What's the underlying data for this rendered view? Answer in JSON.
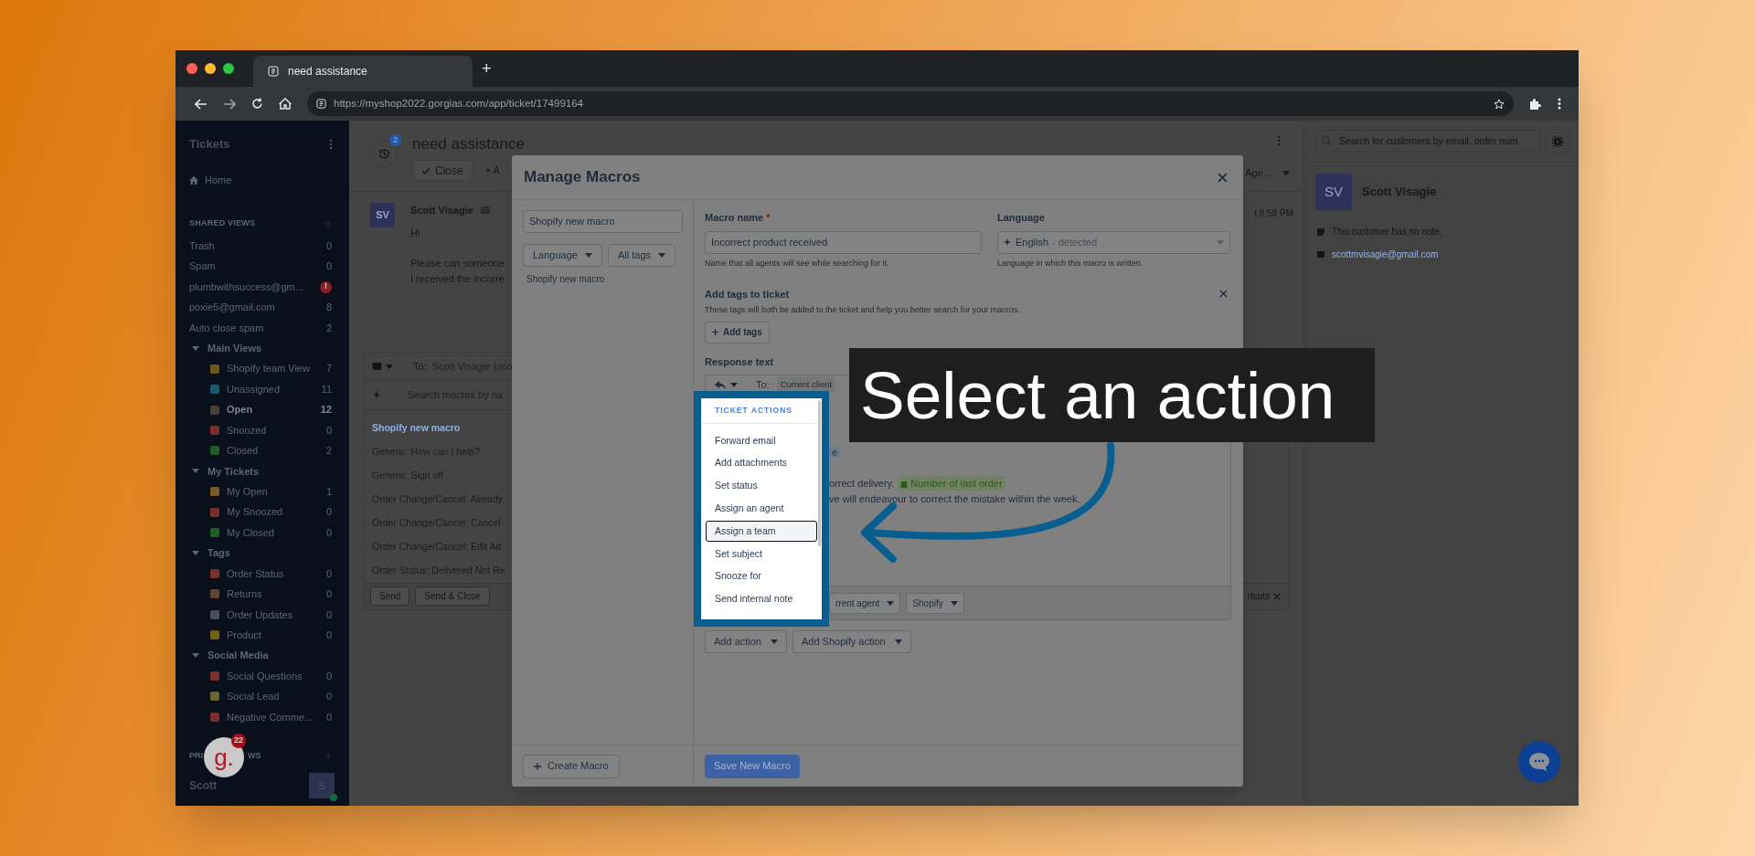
{
  "browser": {
    "tab_title": "need assistance",
    "new_tab": "+",
    "url": "https://myshop2022.gorgias.com/app/ticket/17499164"
  },
  "sidebar": {
    "title": "Tickets",
    "home": "Home",
    "shared_views_label": "SHARED VIEWS",
    "shared_views": [
      {
        "label": "Trash",
        "count": "0",
        "kind": "plain"
      },
      {
        "label": "Spam",
        "count": "0",
        "kind": "plain"
      },
      {
        "label": "plumbwithsuccess@gm...",
        "count": "!",
        "kind": "alert"
      },
      {
        "label": "poxie5@gmail.com",
        "count": "8",
        "kind": "plain"
      },
      {
        "label": "Auto close spam",
        "count": "2",
        "kind": "plain"
      }
    ],
    "groups": [
      {
        "label": "Main Views",
        "expanded": true,
        "children": [
          {
            "label": "Shopify team View",
            "count": "7",
            "color": "#6b5a1c",
            "selected": false
          },
          {
            "label": "Unassigned",
            "count": "11",
            "color": "#1a5a6e",
            "selected": false
          },
          {
            "label": "Open",
            "count": "12",
            "color": "#4a4038",
            "selected": true
          },
          {
            "label": "Snoozed",
            "count": "0",
            "color": "#7a2f2c",
            "selected": false
          },
          {
            "label": "Closed",
            "count": "2",
            "color": "#1f5e27",
            "selected": false
          }
        ]
      },
      {
        "label": "My Tickets",
        "expanded": true,
        "children": [
          {
            "label": "My Open",
            "count": "1",
            "color": "#7a5a22",
            "selected": false
          },
          {
            "label": "My Snoozed",
            "count": "0",
            "color": "#7a2f2c",
            "selected": false
          },
          {
            "label": "My Closed",
            "count": "0",
            "color": "#1f5e27",
            "selected": false
          }
        ]
      },
      {
        "label": "Tags",
        "expanded": true,
        "children": [
          {
            "label": "Order Status",
            "count": "0",
            "color": "#7a2f2c",
            "selected": false
          },
          {
            "label": "Returns",
            "count": "0",
            "color": "#5e4630",
            "selected": false
          },
          {
            "label": "Order Updates",
            "count": "0",
            "color": "#4a4f57",
            "selected": false
          },
          {
            "label": "Product",
            "count": "0",
            "color": "#75600f",
            "selected": false
          }
        ]
      },
      {
        "label": "Social Media",
        "expanded": true,
        "children": [
          {
            "label": "Social Questions",
            "count": "0",
            "color": "#7a2f2c",
            "selected": false
          },
          {
            "label": "Social Lead",
            "count": "0",
            "color": "#6b6330",
            "selected": false
          },
          {
            "label": "Negative Comme...",
            "count": "0",
            "color": "#7a2f2c",
            "selected": false
          }
        ]
      }
    ],
    "private_views_parts": [
      "PRI",
      "WS"
    ],
    "user": "Scott",
    "user_avatar": "S",
    "user_online": true
  },
  "widget": {
    "logo": "g.",
    "badge": "22"
  },
  "ticket": {
    "badge": "2",
    "title": "need assistance",
    "close_button": "Close",
    "add_button_partial": "+ A",
    "assignee_partial": "Age...",
    "time_partial": "t 8:58 PM",
    "message": {
      "avatar": "SV",
      "author": "Scott Visagie",
      "paragraphs": [
        [
          "Hi"
        ],
        [
          "Please can someone",
          "I received the incorre"
        ]
      ]
    },
    "reply": {
      "to_label": "To:",
      "to_value": "Scott Visagie (sco",
      "search_placeholder": "Search macros by na",
      "macros": [
        {
          "label": "Shopify new macro",
          "selected": true
        },
        {
          "label": "Generic: How can I help?",
          "selected": false
        },
        {
          "label": "Generic: Sign off",
          "selected": false
        },
        {
          "label": "Order Change/Cancel: Already",
          "selected": false
        },
        {
          "label": "Order Change/Cancel: Cancel",
          "selected": false
        },
        {
          "label": "Order Change/Cancel: Edit Ad",
          "selected": false
        },
        {
          "label": "Order Status: Delivered Not Re",
          "selected": false
        }
      ],
      "buttons": [
        "Send",
        "Send & Close"
      ],
      "shortcuts_partial": "rtcuts"
    }
  },
  "modal": {
    "title": "Manage Macros",
    "search_value": "Shopify new macro",
    "filters": [
      "Language",
      "All tags"
    ],
    "macro_list": [
      "Shopify new macro"
    ],
    "name_label": "Macro name",
    "required_mark": "*",
    "name_value": "Incorrect product received",
    "name_hint": "Name that all agents will see while searching for it.",
    "language_label": "Language",
    "language_value": "English",
    "language_detected": "- detected",
    "language_hint": "Language in which this macro is written.",
    "tags_title": "Add tags to ticket",
    "tags_hint": "These tags will both be added to the ticket and help you better search for your macros.",
    "add_tags_button": "Add tags",
    "response_label": "Response text",
    "editor": {
      "to_label": "To:",
      "to_chip": "Current client",
      "variable_chip_partial": "e",
      "line1": "orrect delivery.",
      "line1_chip": "Number of last order",
      "line2": "ve will endeavour to correct the mistake within the week.",
      "footer_chips": [
        "rrent agent",
        "Shopify"
      ]
    },
    "action_buttons": [
      "Add action",
      "Add Shopify action"
    ],
    "create_button": "Create Macro",
    "save_button": "Save New Macro"
  },
  "dropdown": {
    "header": "TICKET ACTIONS",
    "items": [
      {
        "label": "Forward email",
        "selected": false
      },
      {
        "label": "Add attachments",
        "selected": false
      },
      {
        "label": "Set status",
        "selected": false
      },
      {
        "label": "Assign an agent",
        "selected": false
      },
      {
        "label": "Assign a team",
        "selected": true
      },
      {
        "label": "Set subject",
        "selected": false
      },
      {
        "label": "Snooze for",
        "selected": false
      },
      {
        "label": "Send internal note",
        "selected": false
      }
    ]
  },
  "customer": {
    "search_placeholder": "Search for customers by email, order num",
    "avatar": "SV",
    "name": "Scott Visagie",
    "note": "This customer has no note.",
    "email": "scottmvisagie@gmail.com"
  },
  "callout": {
    "text": "Select an action"
  }
}
